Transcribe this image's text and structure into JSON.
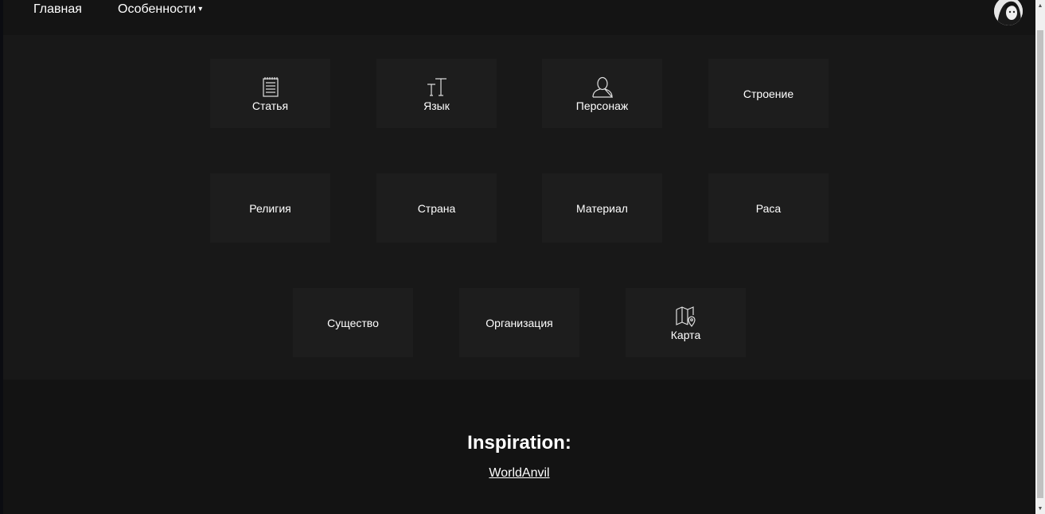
{
  "nav": {
    "home": "Главная",
    "features": "Особенности",
    "caret": "▾"
  },
  "tiles": [
    {
      "label": "Статья",
      "icon": "document-icon"
    },
    {
      "label": "Язык",
      "icon": "text-size-icon"
    },
    {
      "label": "Персонаж",
      "icon": "person-icon"
    },
    {
      "label": "Строение"
    },
    {
      "label": "Религия"
    },
    {
      "label": "Страна"
    },
    {
      "label": "Материал"
    },
    {
      "label": "Раса"
    },
    {
      "label": "Существо"
    },
    {
      "label": "Организация"
    },
    {
      "label": "Карта",
      "icon": "map-icon"
    }
  ],
  "footer": {
    "title": "Inspiration:",
    "link": "WorldAnvil"
  },
  "colors": {
    "background": "#131313",
    "panel": "#181818",
    "tile": "#1d1d1d",
    "text": "#ffffff"
  }
}
